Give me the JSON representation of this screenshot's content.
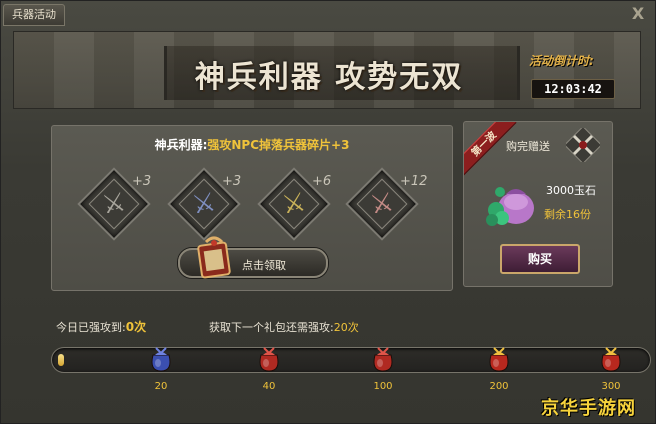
{
  "window": {
    "tab_label": "兵器活动",
    "close_glyph": "Ⅹ"
  },
  "banner": {
    "title": "神兵利器 攻势无双",
    "countdown_label": "活动倒计时:",
    "countdown_value": "12:03:42"
  },
  "left_panel": {
    "header_key": "神兵利器:",
    "header_value": "强攻NPC掉落兵器碎片+3",
    "weapons": [
      {
        "name": "grey",
        "bonus": "+3",
        "color": "#a8a59c"
      },
      {
        "name": "blue",
        "bonus": "+3",
        "color": "#7f8fc0"
      },
      {
        "name": "gold",
        "bonus": "+6",
        "color": "#c9b25a"
      },
      {
        "name": "red",
        "bonus": "+12",
        "color": "#c48b86"
      }
    ],
    "claim_button": "点击领取"
  },
  "right_panel": {
    "ribbon": "第一波",
    "title": "购完赠送",
    "reward_amount": "3000玉石",
    "remaining": "剩余16份",
    "buy_button": "购买"
  },
  "progress": {
    "today_label": "今日已强攻到:",
    "today_value": "0次",
    "next_label": "获取下一个礼包还需强攻:",
    "next_value": "20次",
    "current_fraction": 0.0,
    "milestones": [
      {
        "value": "20",
        "color": "blue"
      },
      {
        "value": "40",
        "color": "red"
      },
      {
        "value": "100",
        "color": "red"
      },
      {
        "value": "200",
        "color": "red-gold"
      },
      {
        "value": "300",
        "color": "red-gold"
      }
    ]
  },
  "watermark": "京华手游网"
}
